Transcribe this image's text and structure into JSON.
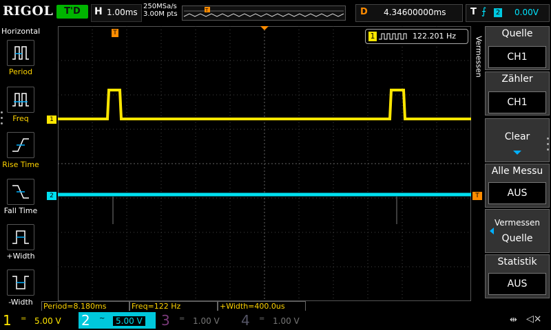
{
  "top": {
    "logo": "RIGOL",
    "run_state": "T'D",
    "timebase_label": "H",
    "timebase_value": "1.00ms",
    "sample_rate": "250MSa/s",
    "memory_depth": "3.00M pts",
    "delay_label": "D",
    "delay_value": "4.34600000ms",
    "trigger_label": "T",
    "trigger_edge": "rising-edge-icon",
    "trigger_channel": "2",
    "trigger_level": "0.00V"
  },
  "left_menu": {
    "title": "Horizontal",
    "items": [
      {
        "label": "Period",
        "icon": "period-icon"
      },
      {
        "label": "Freq",
        "icon": "freq-icon"
      },
      {
        "label": "Rise Time",
        "icon": "rise-time-icon"
      },
      {
        "label": "Fall Time",
        "icon": "fall-time-icon"
      },
      {
        "label": "+Width",
        "icon": "plus-width-icon"
      },
      {
        "label": "-Width",
        "icon": "minus-width-icon"
      }
    ]
  },
  "screen": {
    "freq_readout_channel": "1",
    "freq_readout_value": "122.201 Hz",
    "ch1_marker": "1",
    "ch2_marker": "2",
    "trigger_marker": "T"
  },
  "right_menu": {
    "tab_label": "Vermessen",
    "items": [
      {
        "title": "Quelle",
        "value": "CH1"
      },
      {
        "title": "Zähler",
        "value": "CH1"
      },
      {
        "title": "Clear",
        "value": ""
      },
      {
        "title": "Alle Messu",
        "value": "AUS"
      },
      {
        "title": "Vermessen",
        "value": "Quelle"
      },
      {
        "title": "Statistik",
        "value": "AUS"
      }
    ]
  },
  "measurements": {
    "period": "Period=8.180ms",
    "freq": "Freq=122 Hz",
    "width": "+Width=400.0us"
  },
  "channels": [
    {
      "num": "1",
      "coupling": "=",
      "scale": "5.00 V",
      "color": "#ffe600"
    },
    {
      "num": "2",
      "coupling": "~",
      "scale": "5.00 V",
      "color": "#00e0f0"
    },
    {
      "num": "3",
      "coupling": "=",
      "scale": "1.00 V",
      "color": "#c040c0"
    },
    {
      "num": "4",
      "coupling": "=",
      "scale": "1.00 V",
      "color": "#3050ff"
    }
  ],
  "status": {
    "usb_icon": "usb-icon",
    "sound_icon": "speaker-muted-icon"
  }
}
